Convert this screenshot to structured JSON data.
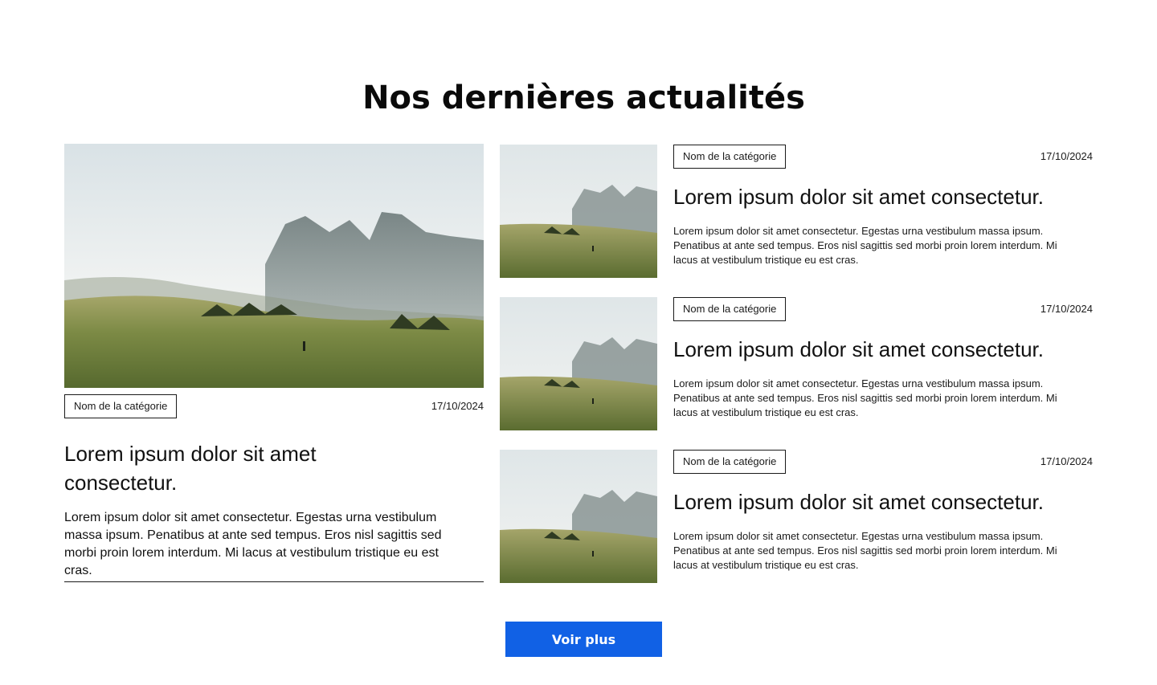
{
  "section": {
    "title": "Nos dernières actualités"
  },
  "featured": {
    "image_icon": "landscape-photo",
    "category": "Nom de la catégorie",
    "date": "17/10/2024",
    "title": "Lorem ipsum dolor sit amet consectetur.",
    "excerpt": "Lorem ipsum dolor sit amet consectetur. Egestas urna vestibulum massa ipsum. Penatibus at ante sed tempus. Eros nisl sagittis sed morbi proin lorem interdum. Mi lacus at vestibulum tristique eu est cras."
  },
  "articles": [
    {
      "category": "Nom de la catégorie",
      "date": "17/10/2024",
      "title": "Lorem ipsum dolor sit amet consectetur.",
      "excerpt": "Lorem ipsum dolor sit amet consectetur. Egestas urna vestibulum massa ipsum. Penatibus at ante sed tempus. Eros nisl sagittis sed morbi proin lorem interdum. Mi lacus at vestibulum tristique eu est cras."
    },
    {
      "category": "Nom de la catégorie",
      "date": "17/10/2024",
      "title": "Lorem ipsum dolor sit amet consectetur.",
      "excerpt": "Lorem ipsum dolor sit amet consectetur. Egestas urna vestibulum massa ipsum. Penatibus at ante sed tempus. Eros nisl sagittis sed morbi proin lorem interdum. Mi lacus at vestibulum tristique eu est cras."
    },
    {
      "category": "Nom de la catégorie",
      "date": "17/10/2024",
      "title": "Lorem ipsum dolor sit amet consectetur.",
      "excerpt": "Lorem ipsum dolor sit amet consectetur. Egestas urna vestibulum massa ipsum. Penatibus at ante sed tempus. Eros nisl sagittis sed morbi proin lorem interdum. Mi lacus at vestibulum tristique eu est cras."
    }
  ],
  "more_button": {
    "label": "Voir plus"
  },
  "colors": {
    "accent": "#1161e5",
    "text": "#111111",
    "border": "#1a1a1a"
  }
}
